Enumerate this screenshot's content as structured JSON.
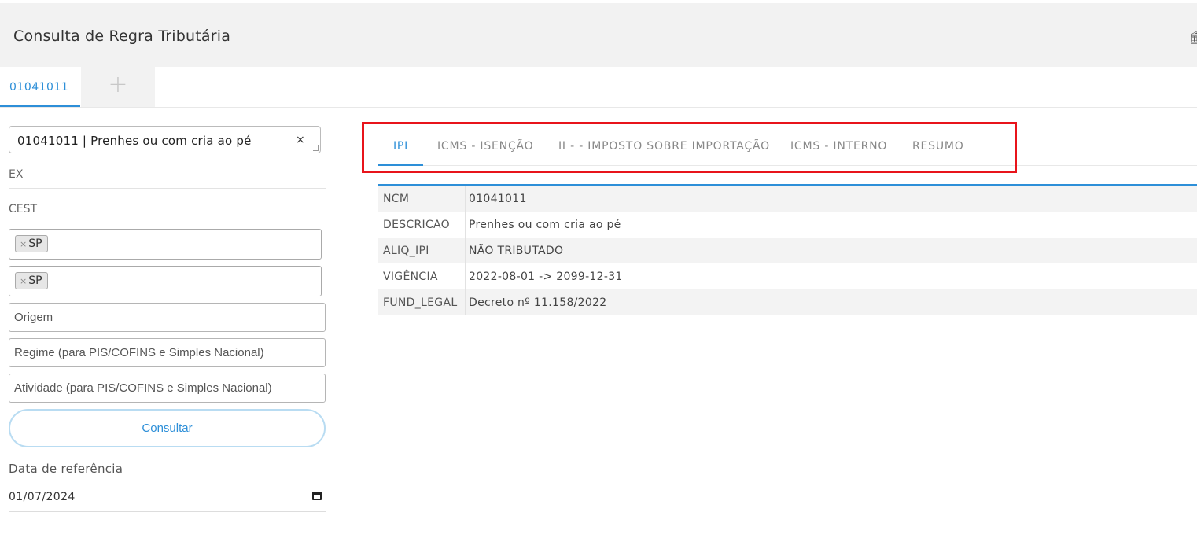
{
  "header": {
    "title": "Consulta de Regra Tributária",
    "corner_icon": "building-icon"
  },
  "tabs": {
    "active_label": "01041011",
    "add_icon": "+"
  },
  "form": {
    "ncm_value": "01041011 | Prenhes ou com cria ao pé",
    "ncm_clear": "×",
    "ex_label": "EX",
    "cest_label": "CEST",
    "uf_origem_tag": "SP",
    "uf_destino_tag": "SP",
    "tag_remove": "×",
    "origem_placeholder": "Origem",
    "regime_placeholder": "Regime (para PIS/COFINS e Simples Nacional)",
    "atividade_placeholder": "Atividade (para PIS/COFINS e Simples Nacional)",
    "consultar_label": "Consultar",
    "ref_date_label": "Data de referência",
    "ref_date_value": "01/07/2024"
  },
  "result_tabs": [
    "IPI",
    "ICMS - ISENÇÃO",
    "II - - IMPOSTO SOBRE IMPORTAÇÃO",
    "ICMS - INTERNO",
    "RESUMO"
  ],
  "result_table": [
    {
      "key": "NCM",
      "value": "01041011"
    },
    {
      "key": "DESCRICAO",
      "value": "Prenhes ou com cria ao pé"
    },
    {
      "key": "ALIQ_IPI",
      "value": "NÃO TRIBUTADO"
    },
    {
      "key": "VIGÊNCIA",
      "value": "2022-08-01 -> 2099-12-31"
    },
    {
      "key": "FUND_LEGAL",
      "value": "Decreto nº 11.158/2022"
    }
  ],
  "colors": {
    "accent": "#2d8fd8",
    "highlight": "#e8141b",
    "header_bg": "#f2f2f2"
  }
}
